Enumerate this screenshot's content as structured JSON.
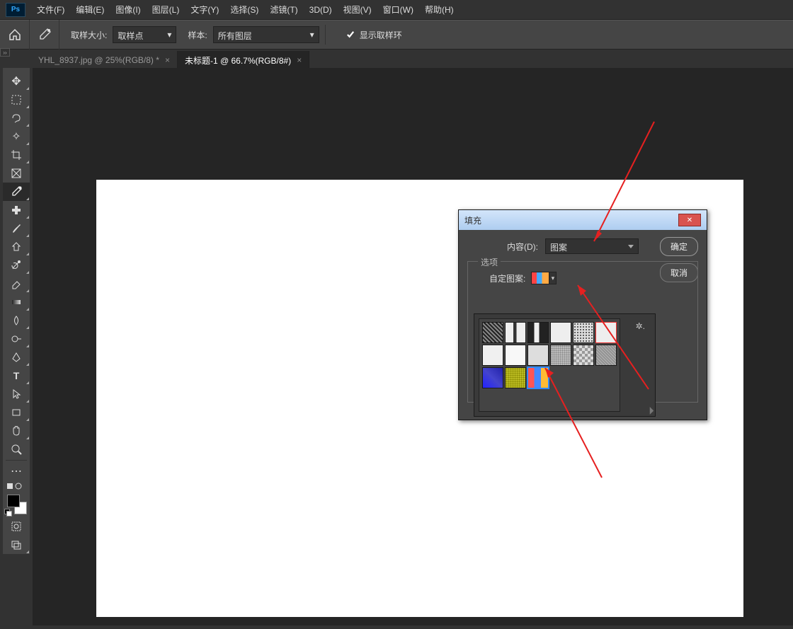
{
  "menu": {
    "items": [
      "文件(F)",
      "编辑(E)",
      "图像(I)",
      "图层(L)",
      "文字(Y)",
      "选择(S)",
      "滤镜(T)",
      "3D(D)",
      "视图(V)",
      "窗口(W)",
      "帮助(H)"
    ]
  },
  "options_bar": {
    "size_label": "取样大小:",
    "size_value": "取样点",
    "sample_label": "样本:",
    "sample_value": "所有图层",
    "show_ring_label": "显示取样环"
  },
  "tabs": [
    {
      "label": "YHL_8937.jpg @ 25%(RGB/8) *",
      "active": false
    },
    {
      "label": "未标题-1 @ 66.7%(RGB/8#)",
      "active": true
    }
  ],
  "dialog": {
    "title": "填充",
    "content_label": "内容(D):",
    "content_value": "图案",
    "options_legend": "选项",
    "custom_pattern_label": "自定图案:",
    "ok": "确定",
    "cancel": "取消"
  },
  "tool_names": [
    "move",
    "rect-marquee",
    "lasso",
    "wand",
    "crop",
    "frame",
    "eyedropper",
    "healing",
    "brush",
    "clone",
    "history-brush",
    "eraser",
    "gradient",
    "blur",
    "dodge",
    "pen",
    "type",
    "path-select",
    "rectangle",
    "hand",
    "zoom"
  ],
  "chart_data": null
}
